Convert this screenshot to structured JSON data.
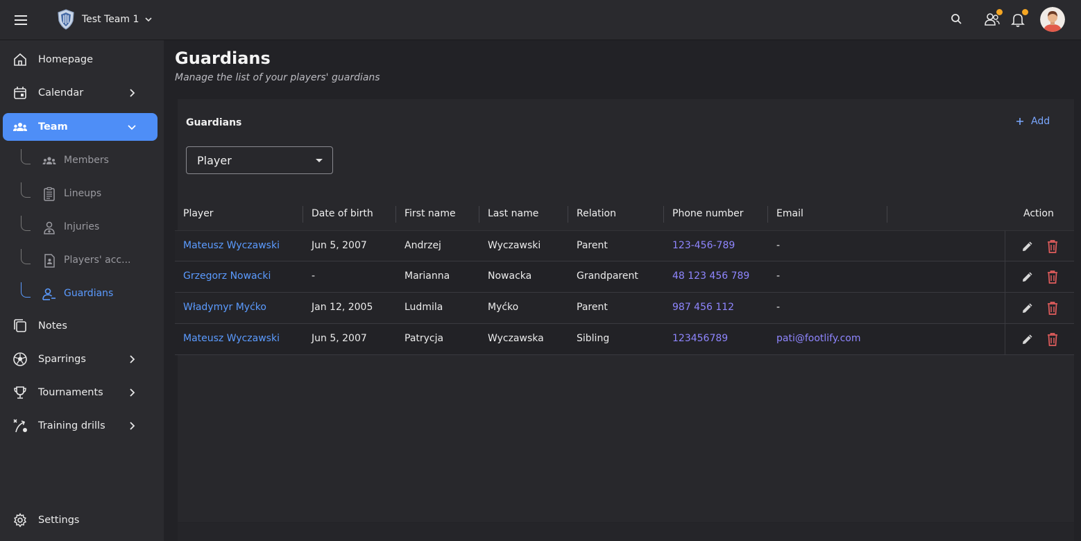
{
  "header": {
    "team_name": "Test Team 1"
  },
  "sidebar": {
    "items": [
      {
        "label": "Homepage"
      },
      {
        "label": "Calendar"
      },
      {
        "label": "Team"
      },
      {
        "label": "Notes"
      },
      {
        "label": "Sparrings"
      },
      {
        "label": "Tournaments"
      },
      {
        "label": "Training drills"
      }
    ],
    "team_sub": [
      {
        "label": "Members"
      },
      {
        "label": "Lineups"
      },
      {
        "label": "Injuries"
      },
      {
        "label": "Players' acc..."
      },
      {
        "label": "Guardians"
      }
    ],
    "settings_label": "Settings"
  },
  "page": {
    "title": "Guardians",
    "subtitle": "Manage the list of your players' guardians"
  },
  "card": {
    "title": "Guardians",
    "add_label": "Add",
    "filter_value": "Player"
  },
  "table": {
    "headers": {
      "player": "Player",
      "dob": "Date of birth",
      "first": "First name",
      "last": "Last name",
      "relation": "Relation",
      "phone": "Phone number",
      "email": "Email",
      "action": "Action"
    },
    "rows": [
      {
        "player": "Mateusz Wyczawski",
        "dob": "Jun 5, 2007",
        "first": "Andrzej",
        "last": "Wyczawski",
        "relation": "Parent",
        "phone": "123-456-789",
        "email": "-"
      },
      {
        "player": "Grzegorz Nowacki",
        "dob": "-",
        "first": "Marianna",
        "last": "Nowacka",
        "relation": "Grandparent",
        "phone": "48 123 456 789",
        "email": "-"
      },
      {
        "player": "Władymyr Myćko",
        "dob": "Jan 12, 2005",
        "first": "Ludmila",
        "last": "Myćko",
        "relation": "Parent",
        "phone": "987 456 112",
        "email": "-"
      },
      {
        "player": "Mateusz Wyczawski",
        "dob": "Jun 5, 2007",
        "first": "Patrycja",
        "last": "Wyczawska",
        "relation": "Sibling",
        "phone": "123456789",
        "email": "pati@footlify.com"
      }
    ]
  },
  "colors": {
    "accent": "#4e8ef7",
    "link": "#5b9bff",
    "phone_email": "#8f86ff",
    "delete": "#e35d5d",
    "badge": "#f5a623"
  }
}
